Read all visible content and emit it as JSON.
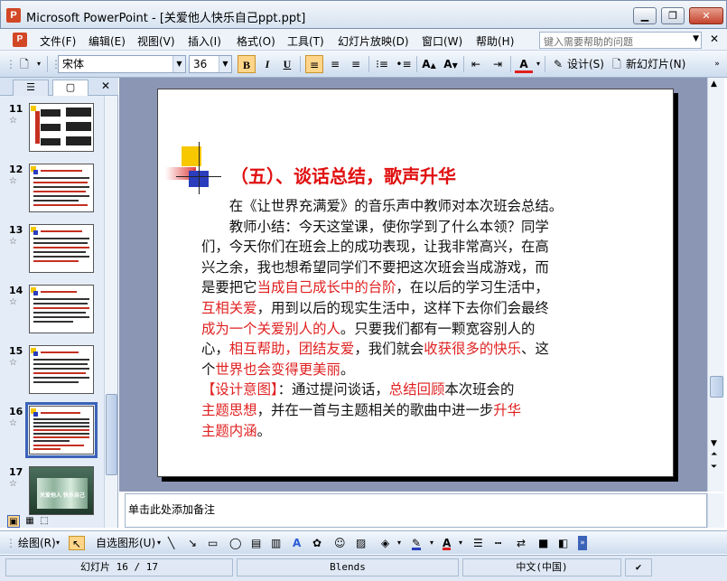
{
  "window": {
    "title": "Microsoft PowerPoint - [关爱他人快乐自己ppt.ppt]",
    "min_glyph": "▁",
    "max_glyph": "❐",
    "close_glyph": "✕"
  },
  "menu": {
    "items": [
      "文件(F)",
      "编辑(E)",
      "视图(V)",
      "插入(I)",
      "格式(O)",
      "工具(T)",
      "幻灯片放映(D)",
      "窗口(W)",
      "帮助(H)"
    ],
    "help_placeholder": "键入需要帮助的问题",
    "close_glyph": "✕"
  },
  "toolbar": {
    "font_name": "宋体",
    "font_size": "36",
    "bold": "B",
    "italic": "I",
    "underline": "U",
    "design_label": "设计(S)",
    "new_slide_label": "新幻灯片(N)"
  },
  "left_pane": {
    "tab_outline_glyph": "☰",
    "tab_slides_glyph": "▢",
    "close_glyph": "✕",
    "star_glyph": "☆",
    "thumbnails": [
      {
        "num": "11"
      },
      {
        "num": "12"
      },
      {
        "num": "13"
      },
      {
        "num": "14"
      },
      {
        "num": "15"
      },
      {
        "num": "16",
        "selected": true
      },
      {
        "num": "17"
      }
    ],
    "thumb17_caption": "关爱他人 快乐自己"
  },
  "slide": {
    "heading": "（五）、谈话总结，歌声升华",
    "lines": [
      [
        {
          "t": "　　在《让世界充满爱》的音乐声中教师对本次班会总结。"
        }
      ],
      [
        {
          "t": "　　教师小结：今天这堂课，使你学到了什么本领？同学"
        }
      ],
      [
        {
          "t": "们，今天你们在班会上的成功表现，让我非常高兴，在高"
        }
      ],
      [
        {
          "t": "兴之余，我也想希望同学们不要把这次班会当成游戏，而"
        }
      ],
      [
        {
          "t": "是要把它"
        },
        {
          "t": "当成自己成长中的台阶",
          "red": true
        },
        {
          "t": "，在以后的学习生活中，"
        }
      ],
      [
        {
          "t": "互相关爱",
          "red": true
        },
        {
          "t": "，用到以后的现实生活中，这样下去你们会最终"
        }
      ],
      [
        {
          "t": "成为一个关爱别人的人",
          "red": true
        },
        {
          "t": "。只要我们都有一颗宽容别人的"
        }
      ],
      [
        {
          "t": "心，"
        },
        {
          "t": "相互帮助，团结友爱",
          "red": true
        },
        {
          "t": "，我们就会"
        },
        {
          "t": "收获很多的快乐",
          "red": true
        },
        {
          "t": "、这"
        }
      ],
      [
        {
          "t": "个"
        },
        {
          "t": "世界也会变得更美丽",
          "red": true
        },
        {
          "t": "。"
        }
      ],
      [
        {
          "t": "【设计意图】",
          "red": true
        },
        {
          "t": "：通过提问谈话，"
        },
        {
          "t": "总结回顾",
          "red": true
        },
        {
          "t": "本次班会的"
        }
      ],
      [
        {
          "t": " 主题思想",
          "red": true
        },
        {
          "t": "，并在一首与主题相关的歌曲中进一步"
        },
        {
          "t": "升华",
          "red": true
        }
      ],
      [
        {
          "t": " 主题内涵",
          "red": true
        },
        {
          "t": "。"
        }
      ]
    ]
  },
  "notes": {
    "placeholder": "单击此处添加备注"
  },
  "draw_toolbar": {
    "draw_label": "绘图(R)",
    "autoshapes_label": "自选图形(U)"
  },
  "status": {
    "slide_info": "幻灯片 16 / 17",
    "design": "Blends",
    "language": "中文(中国)"
  },
  "colors": {
    "accent_red": "#e02020",
    "slide_bg": "#ffffff",
    "workspace": "#8b96b5"
  }
}
